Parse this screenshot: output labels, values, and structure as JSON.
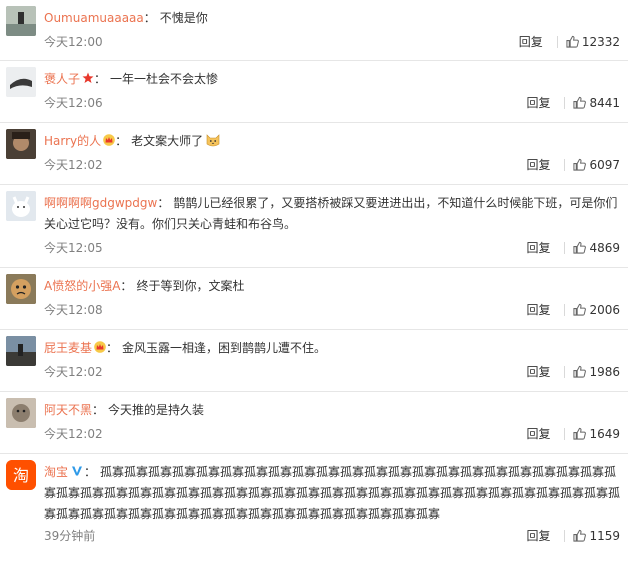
{
  "comments": [
    {
      "user": "Oumuamuaaaaa",
      "sep": "：",
      "text": "不愧是你",
      "time": "今天12:00",
      "reply": "回复",
      "likes": "12332",
      "avatar_color": "#9aa59a",
      "badge": ""
    },
    {
      "user": "褒人子",
      "sep": "：",
      "text": "一年一杜会不会太惨",
      "time": "今天12:06",
      "reply": "回复",
      "likes": "8441",
      "avatar_color": "#cfd3d6",
      "badge": "star-badge-icon"
    },
    {
      "user": "Harry的人",
      "sep": "：",
      "text": "老文案大师了",
      "time": "今天12:02",
      "reply": "回复",
      "likes": "6097",
      "avatar_color": "#5b4a3a",
      "badge": "crown-badge-icon"
    },
    {
      "user": "啊啊啊啊gdgwpdgw",
      "sep": "：",
      "text": "鹊鹊儿已经很累了，又要搭桥被踩又要进进出出，不知道什么时候能下班，可是你们关心过它吗？没有。你们只关心青蛙和布谷鸟。",
      "time": "今天12:05",
      "reply": "回复",
      "likes": "4869",
      "avatar_color": "#dfe6ee",
      "badge": ""
    },
    {
      "user": "A愤怒的小强A",
      "sep": "：",
      "text": "终于等到你，文案杜",
      "time": "今天12:08",
      "reply": "回复",
      "likes": "2006",
      "avatar_color": "#6b5a3e",
      "badge": ""
    },
    {
      "user": "屁王麦基",
      "sep": "：",
      "text": "金风玉露一相逢，困到鹊鹊儿遭不住。",
      "time": "今天12:02",
      "reply": "回复",
      "likes": "1986",
      "avatar_color": "#3f4b5a",
      "badge": "crown-badge-icon"
    },
    {
      "user": "阿天不黑",
      "sep": "：",
      "text": "今天推的是持久装",
      "time": "今天12:02",
      "reply": "回复",
      "likes": "1649",
      "avatar_color": "#a89a8a",
      "badge": ""
    },
    {
      "user": "淘宝",
      "sep": "：",
      "text": "孤寡孤寡孤寡孤寡孤寡孤寡孤寡孤寡孤寡孤寡孤寡孤寡孤寡孤寡孤寡孤寡孤寡孤寡孤寡孤寡孤寡孤寡孤寡孤寡孤寡孤寡孤寡孤寡孤寡孤寡孤寡孤寡孤寡孤寡孤寡孤寡孤寡孤寡孤寡孤寡孤寡孤寡孤寡孤寡孤寡孤寡孤寡孤寡孤寡孤寡孤寡孤寡孤寡孤寡孤寡孤寡孤寡孤寡孤寡孤寡孤寡孤寡",
      "time": "39分钟前",
      "reply": "回复",
      "likes": "1159",
      "avatar_color": "#ff5000",
      "badge": "verified-v-icon",
      "avatar_glyph": "淘"
    }
  ]
}
